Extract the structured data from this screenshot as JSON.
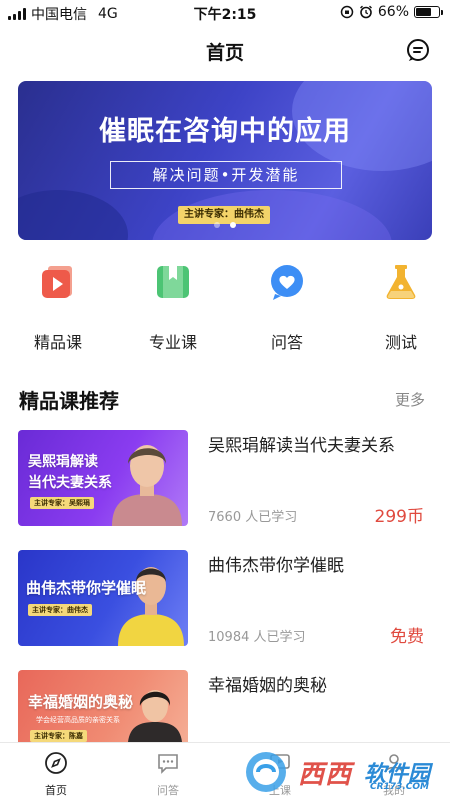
{
  "status_bar": {
    "carrier": "中国电信",
    "network": "4G",
    "time": "下午2:15",
    "battery": "66%",
    "battery_level": 0.66
  },
  "nav": {
    "title": "首页",
    "message_icon": "message-icon"
  },
  "banner": {
    "title": "催眠在咨询中的应用",
    "subtitle": "解决问题•开发潜能",
    "expert": "主讲专家：曲伟杰",
    "slide_count": 2,
    "active_slide": 2
  },
  "categories": [
    {
      "label": "精品课",
      "icon": "video-play-icon",
      "color": "#ee5a4a"
    },
    {
      "label": "专业课",
      "icon": "book-icon",
      "color": "#4cc474"
    },
    {
      "label": "问答",
      "icon": "chat-heart-icon",
      "color": "#3d8ef5"
    },
    {
      "label": "测试",
      "icon": "flask-icon",
      "color": "#f2b330"
    }
  ],
  "section": {
    "title": "精品课推荐",
    "more": "更多"
  },
  "courses": [
    {
      "title": "吴熙琄解读当代夫妻关系",
      "thumb_title_1": "吴熙琄解读",
      "thumb_title_2": "当代夫妻关系",
      "thumb_tag": "主讲专家：吴熙琄",
      "learners": "7660 人已学习",
      "price": "299币"
    },
    {
      "title": "曲伟杰带你学催眠",
      "thumb_title_1": "曲伟杰带你学催眠",
      "thumb_tag": "主讲专家：曲伟杰",
      "learners": "10984 人已学习",
      "price": "免费"
    },
    {
      "title": "幸福婚姻的奥秘",
      "thumb_title_1": "幸福婚姻的奥秘",
      "thumb_sub": "学会经营高品质的亲密关系",
      "thumb_tag": "主讲专家：陈嘉"
    }
  ],
  "tabbar": [
    {
      "label": "首页",
      "icon": "compass-icon",
      "active": true
    },
    {
      "label": "问答",
      "icon": "chat-icon",
      "active": false
    },
    {
      "label": "上课",
      "icon": "class-icon",
      "active": false
    },
    {
      "label": "我的",
      "icon": "user-icon",
      "active": false
    }
  ],
  "watermark": {
    "brand": "西西",
    "brand2": "软件园",
    "url": "CR173.COM"
  },
  "colors": {
    "price_red": "#e04a3f",
    "banner_blue": "#3d43c6"
  }
}
